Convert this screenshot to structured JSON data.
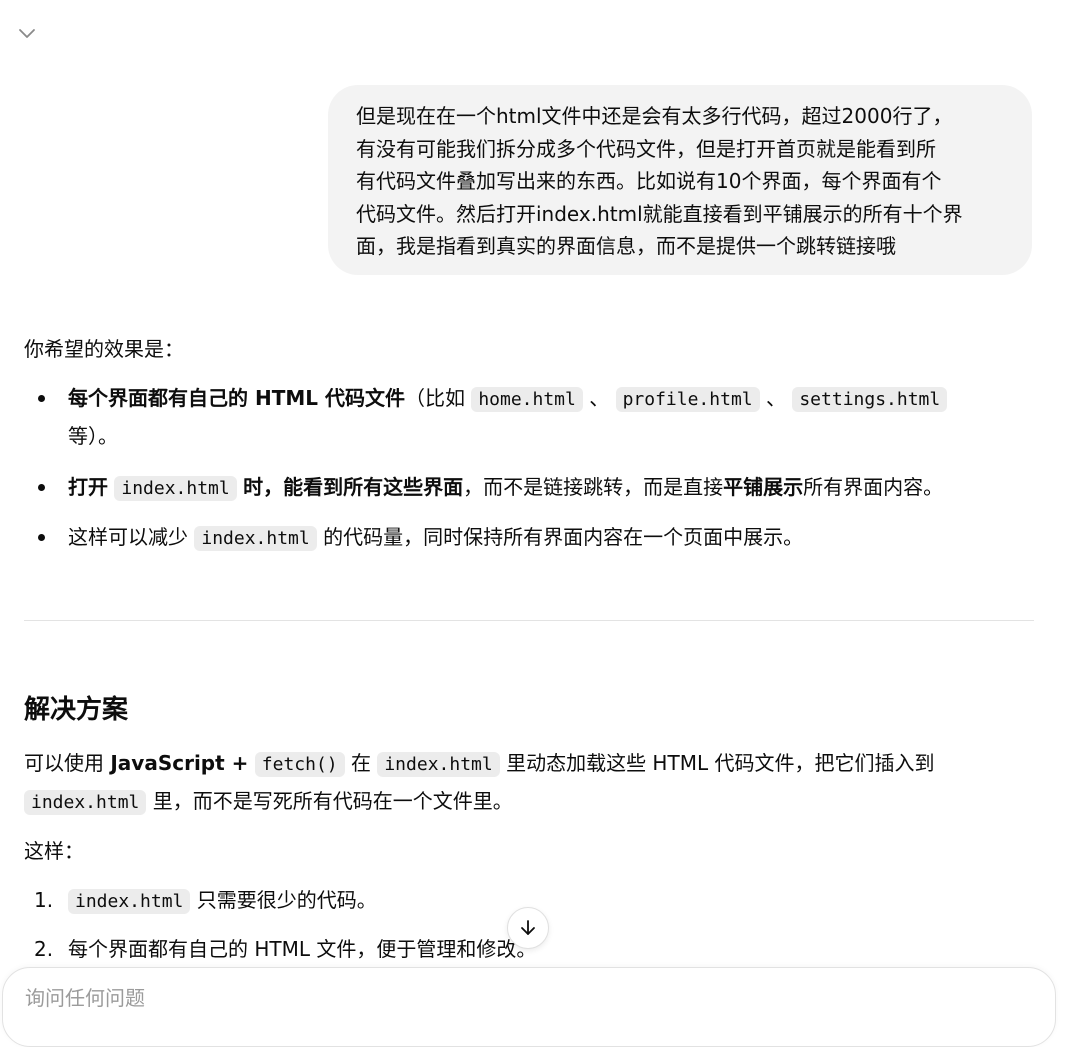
{
  "user_message": {
    "lines": [
      "但是现在在一个html文件中还是会有太多行代码，超过2000行了，",
      "有没有可能我们拆分成多个代码文件，但是打开首页就是能看到所",
      "有代码文件叠加写出来的东西。比如说有10个界面，每个界面有个",
      "代码文件。然后打开index.html就能直接看到平铺展示的所有十个界",
      "面，我是指看到真实的界面信息，而不是提供一个跳转链接哦"
    ]
  },
  "assistant": {
    "intro": "你希望的效果是：",
    "bullet1": {
      "bold": "每个界面都有自己的 HTML 代码文件",
      "paren_open": "（比如",
      "code1": "home.html",
      "sep1": "、",
      "code2": "profile.html",
      "sep2": "、",
      "code3": "settings.html",
      "tail": "等）。"
    },
    "bullet2": {
      "bold_a": "打开",
      "code": "index.html",
      "bold_b": "时，能看到所有这些界面",
      "text_a": "，而不是链接跳转，而是直接",
      "bold_c": "平铺展示",
      "text_b": "所有界面内容。"
    },
    "bullet3": {
      "text_a": "这样可以减少",
      "code": "index.html",
      "text_b": "的代码量，同时保持所有界面内容在一个页面中展示。"
    },
    "heading": "解决方案",
    "solution": {
      "text_a": "可以使用",
      "bold": "JavaScript +",
      "code1": "fetch()",
      "text_b": "在",
      "code2": "index.html",
      "text_c": "里动态加载这些 HTML 代码文件，把它们插入到",
      "code3": "index.html",
      "text_d": "里，而不是写死所有代码在一个文件里。"
    },
    "so": "这样：",
    "list": [
      {
        "num": "1.",
        "code": "index.html",
        "text": "只需要很少的代码。"
      },
      {
        "num": "2.",
        "text": "每个界面都有自己的 HTML 文件，便于管理和修改。"
      }
    ]
  },
  "composer": {
    "placeholder": "询问任何问题"
  },
  "icons": {
    "collapse": "chevron-down-icon",
    "scroll": "arrow-down-icon"
  }
}
